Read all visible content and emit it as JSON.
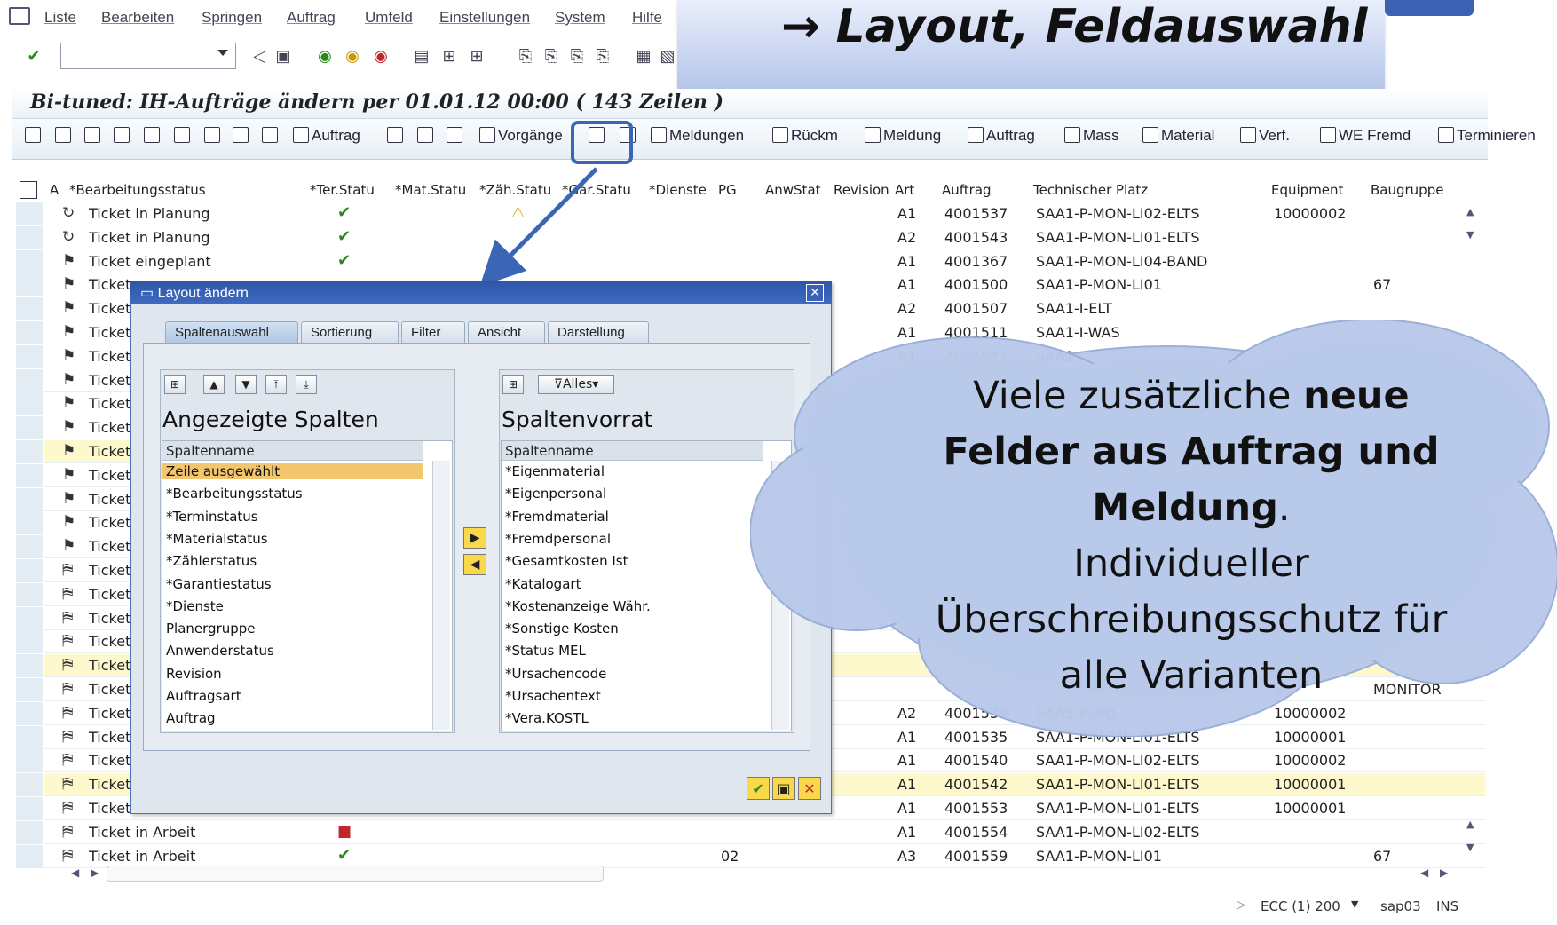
{
  "menu": [
    "Liste",
    "Bearbeiten",
    "Springen",
    "Auftrag",
    "Umfeld",
    "Einstellungen",
    "System",
    "Hilfe"
  ],
  "banner": "→ Layout, Feldauswahl",
  "title": "Bi-tuned: IH-Aufträge ändern per 01.01.12 00:00 ( 143 Zeilen )",
  "app_toolbar": {
    "auftrag1": "Auftrag",
    "vorgaenge": "Vorgänge",
    "meldungen": "Meldungen",
    "rueckm": "Rückm",
    "meldung": "Meldung",
    "auftrag2": "Auftrag",
    "mass": "Mass",
    "material": "Material",
    "verf": "Verf.",
    "we_fremd": "WE Fremd",
    "terminieren": "Terminieren"
  },
  "grid": {
    "headers": [
      "A",
      "*Bearbeitungsstatus",
      "*Ter.Statu",
      "*Mat.Statu",
      "*Zäh.Statu",
      "*Gar.Statu",
      "*Dienste",
      "PG",
      "AnwStat",
      "Revision",
      "Art",
      "Auftrag",
      "Technischer Platz",
      "Equipment",
      "Baugruppe"
    ],
    "rows": [
      {
        "status": "Ticket in Planung",
        "art": "A1",
        "auftrag": "4001537",
        "platz": "SAA1-P-MON-LI02-ELTS",
        "equip": "10000002",
        "bg": ""
      },
      {
        "status": "Ticket in Planung",
        "art": "A2",
        "auftrag": "4001543",
        "platz": "SAA1-P-MON-LI01-ELTS",
        "equip": "",
        "bg": ""
      },
      {
        "status": "Ticket eingeplant",
        "art": "A1",
        "auftrag": "4001367",
        "platz": "SAA1-P-MON-LI04-BAND",
        "equip": "",
        "bg": ""
      },
      {
        "status": "Ticket",
        "art": "A1",
        "auftrag": "4001500",
        "platz": "SAA1-P-MON-LI01",
        "equip": "",
        "bg": "67"
      },
      {
        "status": "Ticket",
        "art": "A2",
        "auftrag": "4001507",
        "platz": "SAA1-I-ELT",
        "equip": "",
        "bg": ""
      },
      {
        "status": "Ticket",
        "art": "A1",
        "auftrag": "4001511",
        "platz": "SAA1-I-WAS",
        "equip": "",
        "bg": ""
      },
      {
        "status": "Ticket",
        "art": "A1",
        "auftrag": "4001541",
        "platz": "SAA1",
        "equip": "",
        "bg": ""
      },
      {
        "status": "Ticket",
        "art": "",
        "auftrag": "",
        "platz": "",
        "equip": "",
        "bg": ""
      },
      {
        "status": "Ticket",
        "art": "",
        "auftrag": "",
        "platz": "",
        "equip": "",
        "bg": ""
      },
      {
        "status": "Ticket",
        "art": "",
        "auftrag": "",
        "platz": "",
        "equip": "",
        "bg": ""
      },
      {
        "status": "Ticket",
        "art": "",
        "auftrag": "",
        "platz": "",
        "equip": "",
        "bg": ""
      },
      {
        "status": "Ticket",
        "art": "",
        "auftrag": "",
        "platz": "",
        "equip": "",
        "bg": ""
      },
      {
        "status": "Ticket",
        "art": "",
        "auftrag": "",
        "platz": "",
        "equip": "",
        "bg": ""
      },
      {
        "status": "Ticket",
        "art": "",
        "auftrag": "",
        "platz": "",
        "equip": "",
        "bg": ""
      },
      {
        "status": "Ticket",
        "art": "",
        "auftrag": "",
        "platz": "",
        "equip": "",
        "bg": ""
      },
      {
        "status": "Ticket",
        "art": "",
        "auftrag": "",
        "platz": "",
        "equip": "",
        "bg": ""
      },
      {
        "status": "Ticket",
        "art": "",
        "auftrag": "",
        "platz": "",
        "equip": "",
        "bg": ""
      },
      {
        "status": "Ticket",
        "art": "",
        "auftrag": "",
        "platz": "",
        "equip": "",
        "bg": ""
      },
      {
        "status": "Ticket",
        "art": "",
        "auftrag": "",
        "platz": "",
        "equip": "",
        "bg": ""
      },
      {
        "status": "Ticket",
        "art": "",
        "auftrag": "",
        "platz": "",
        "equip": "",
        "bg": ""
      },
      {
        "status": "Ticket",
        "art": "",
        "auftrag": "",
        "platz": "",
        "equip": "2",
        "bg": "MONITOR"
      },
      {
        "status": "Ticket",
        "art": "A2",
        "auftrag": "4001539",
        "platz": "SAA1-P-MO",
        "equip": "10000002",
        "bg": ""
      },
      {
        "status": "Ticket",
        "art": "A1",
        "auftrag": "4001535",
        "platz": "SAA1-P-MON-LI01-ELTS",
        "equip": "10000001",
        "bg": ""
      },
      {
        "status": "Ticket",
        "art": "A1",
        "auftrag": "4001540",
        "platz": "SAA1-P-MON-LI02-ELTS",
        "equip": "10000002",
        "bg": ""
      },
      {
        "status": "Ticket",
        "art": "A1",
        "auftrag": "4001542",
        "platz": "SAA1-P-MON-LI01-ELTS",
        "equip": "10000001",
        "bg": ""
      },
      {
        "status": "Ticket",
        "art": "A1",
        "auftrag": "4001553",
        "platz": "SAA1-P-MON-LI01-ELTS",
        "equip": "10000001",
        "bg": ""
      },
      {
        "status": "Ticket in Arbeit",
        "art": "A1",
        "auftrag": "4001554",
        "platz": "SAA1-P-MON-LI02-ELTS",
        "equip": "",
        "bg": ""
      },
      {
        "status": "Ticket in Arbeit",
        "art": "A3",
        "auftrag": "4001559",
        "platz": "SAA1-P-MON-LI01",
        "equip": "",
        "bg": "67",
        "pg": "02"
      }
    ]
  },
  "dialog": {
    "title": "Layout ändern",
    "tabs": [
      "Spaltenauswahl",
      "Sortierung",
      "Filter",
      "Ansicht",
      "Darstellung"
    ],
    "left_title": "Angezeigte Spalten",
    "right_title": "Spaltenvorrat",
    "col_header": "Spaltenname",
    "alles": "Alles",
    "left_items": [
      "Zeile ausgewählt",
      "*Bearbeitungsstatus",
      "*Terminstatus",
      "*Materialstatus",
      "*Zählerstatus",
      "*Garantiestatus",
      "*Dienste",
      "Planergruppe",
      "Anwenderstatus",
      "Revision",
      "Auftragsart",
      "Auftrag"
    ],
    "right_items": [
      "*Eigenmaterial",
      "*Eigenpersonal",
      "*Fremdmaterial",
      "*Fremdpersonal",
      "*Gesamtkosten Ist",
      "*Katalogart",
      "*Kostenanzeige Währ.",
      "*Sonstige Kosten",
      "*Status MEL",
      "*Ursachencode",
      "*Ursachentext",
      "*Vera.KOSTL"
    ]
  },
  "cloud": {
    "l1a": "Viele zusätzliche ",
    "l1b": "neue",
    "l2": "Felder aus Auftrag und",
    "l3a": "Meldung",
    "l3b": ".",
    "l4": "Individueller",
    "l5": "Überschreibungsschutz für",
    "l6": "alle Varianten"
  },
  "status": {
    "system": "ECC (1) 200",
    "server": "sap03",
    "mode": "INS"
  },
  "colors": {
    "accent": "#3a66b5",
    "highlight_row": "#fdf9cc",
    "dialog_head": "#2d56a8",
    "cloud": "#b9c9ea"
  }
}
